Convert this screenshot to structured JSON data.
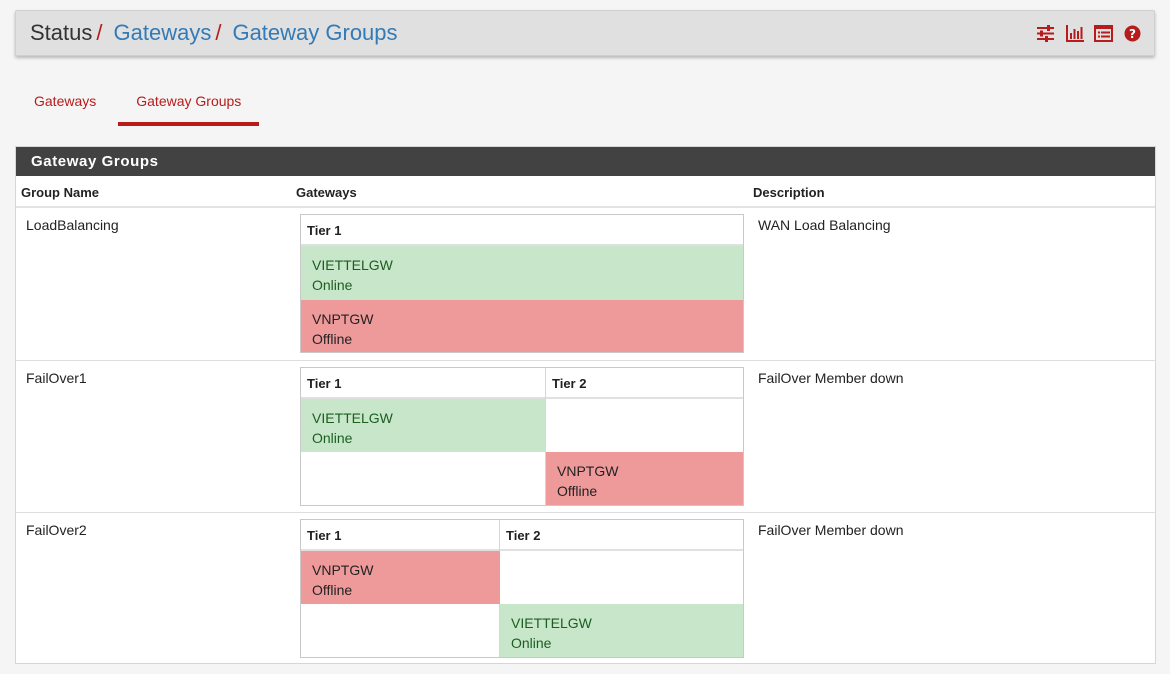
{
  "breadcrumb": {
    "status": "Status",
    "sep1": "/",
    "gateways": "Gateways",
    "sep2": "/",
    "gateway_groups": "Gateway Groups"
  },
  "header_icons": [
    "sliders-icon",
    "bar-chart-icon",
    "list-icon",
    "help-icon"
  ],
  "tabs": [
    {
      "label": "Gateways",
      "active": false
    },
    {
      "label": "Gateway Groups",
      "active": true
    }
  ],
  "panel": {
    "title": "Gateway Groups",
    "columns": {
      "group_name": "Group Name",
      "gateways": "Gateways",
      "description": "Description"
    },
    "groups": [
      {
        "name": "LoadBalancing",
        "description": "WAN Load Balancing",
        "tiers": [
          "Tier 1"
        ],
        "gateways": [
          {
            "name": "VIETTELGW",
            "status": "Online"
          },
          {
            "name": "VNPTGW",
            "status": "Offline"
          }
        ]
      },
      {
        "name": "FailOver1",
        "description": "FailOver Member down",
        "tiers": [
          "Tier 1",
          "Tier 2"
        ],
        "gateways": [
          {
            "name": "VIETTELGW",
            "status": "Online"
          },
          {
            "name": "VNPTGW",
            "status": "Offline"
          }
        ]
      },
      {
        "name": "FailOver2",
        "description": "FailOver Member down",
        "tiers": [
          "Tier 1",
          "Tier 2"
        ],
        "gateways": [
          {
            "name": "VNPTGW",
            "status": "Offline"
          },
          {
            "name": "VIETTELGW",
            "status": "Online"
          }
        ]
      }
    ]
  },
  "colors": {
    "accent": "#b71c1c",
    "link": "#337ab7",
    "online": "#c8e6c9",
    "offline": "#ef9a9a",
    "panel_heading": "#424242"
  }
}
